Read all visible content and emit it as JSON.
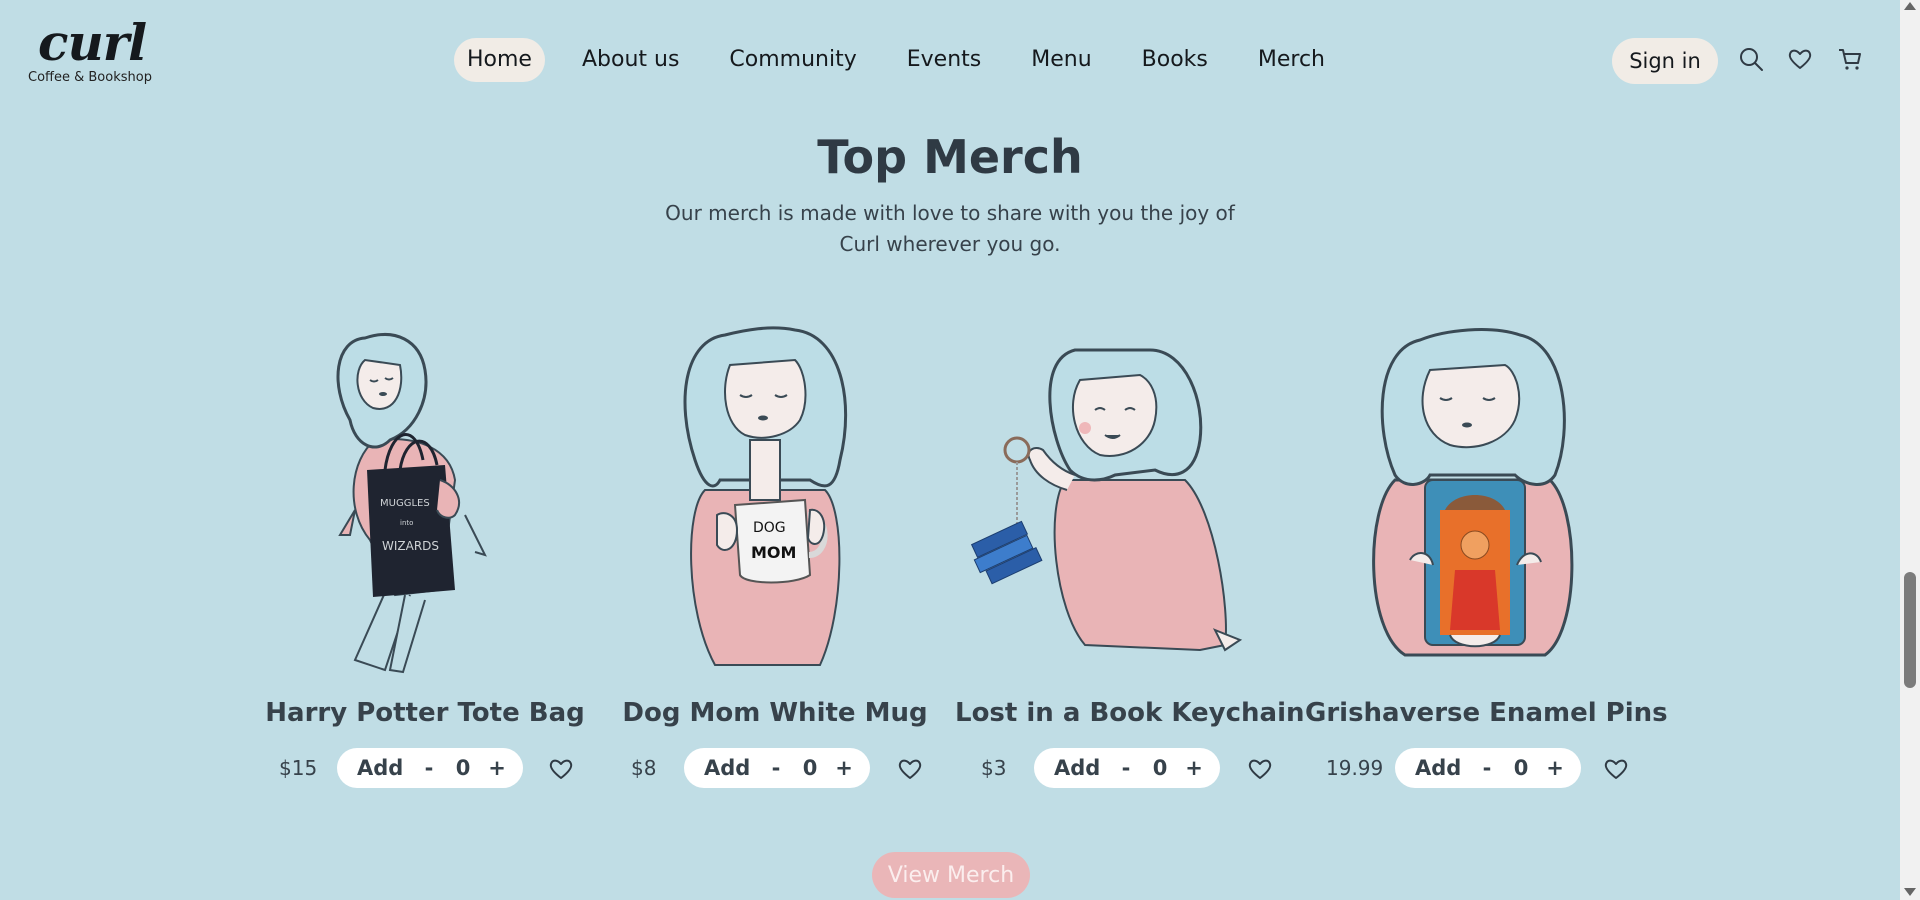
{
  "brand": {
    "name": "curl",
    "tagline": "Coffee & Bookshop"
  },
  "nav": {
    "items": [
      "Home",
      "About us",
      "Community",
      "Events",
      "Menu",
      "Books",
      "Merch"
    ],
    "active": "Home"
  },
  "header": {
    "signin_label": "Sign in",
    "icons": [
      "search-icon",
      "heart-icon",
      "cart-icon"
    ]
  },
  "section": {
    "title": "Top Merch",
    "subtitle_line1": "Our merch is made with love to share with you the joy of",
    "subtitle_line2": "Curl wherever you go."
  },
  "products": [
    {
      "name": "Harry Potter Tote Bag",
      "price": "$15",
      "add_label": "Add",
      "minus": "-",
      "count": "0",
      "plus": "+",
      "item_text": [
        "MUGGLES",
        "into",
        "WIZARDS"
      ]
    },
    {
      "name": "Dog Mom White Mug",
      "price": "$8",
      "add_label": "Add",
      "minus": "-",
      "count": "0",
      "plus": "+",
      "item_text": [
        "DOG",
        "MOM"
      ]
    },
    {
      "name": "Lost in a Book Keychain",
      "price": "$3",
      "add_label": "Add",
      "minus": "-",
      "count": "0",
      "plus": "+"
    },
    {
      "name": "Grishaverse Enamel Pins",
      "price": "19.99",
      "add_label": "Add",
      "minus": "-",
      "count": "0",
      "plus": "+"
    }
  ],
  "view_merch_label": "View Merch",
  "colors": {
    "background": "#c0dde5",
    "pill": "#f1ece6",
    "sweater": "#e9b4b6",
    "hair": "#bcdde6",
    "outline": "#3a4a55",
    "view_merch": "#eab6b8"
  }
}
